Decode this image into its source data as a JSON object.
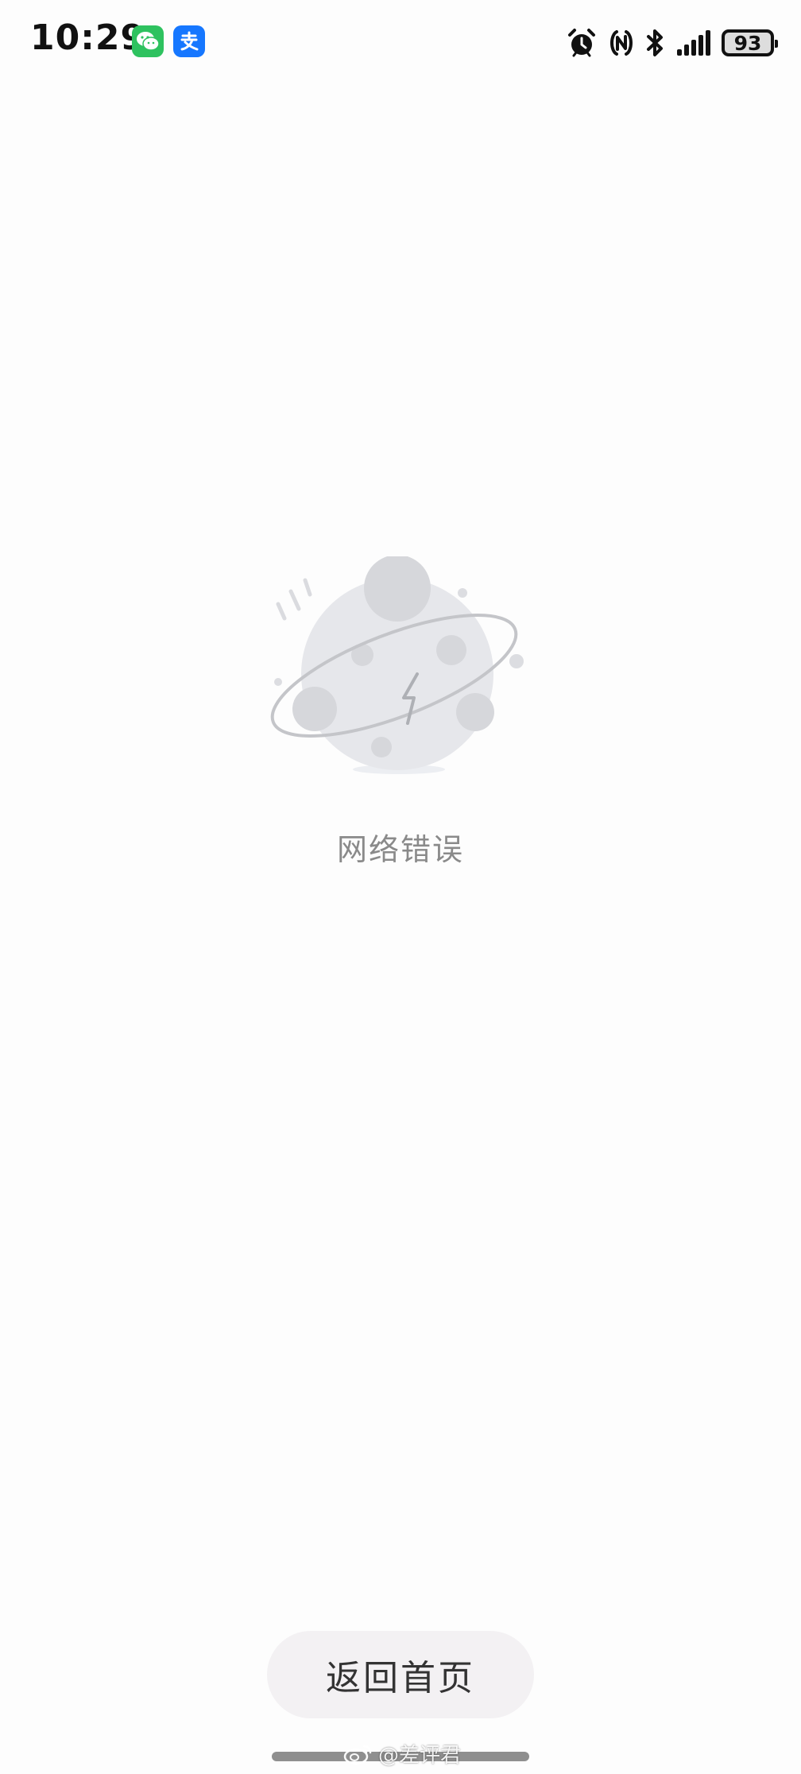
{
  "status_bar": {
    "time": "10:29",
    "battery_level": "93",
    "notification_apps": [
      "wechat-icon",
      "alipay-icon"
    ],
    "indicators": [
      "alarm-icon",
      "nfc-icon",
      "bluetooth-icon",
      "signal-icon",
      "battery-icon"
    ]
  },
  "error": {
    "illustration": "planet-broken-connection-icon",
    "message": "网络错误"
  },
  "actions": {
    "home_button_label": "返回首页"
  },
  "watermark": {
    "text": "@差评君"
  },
  "colors": {
    "background": "#fdfdfd",
    "message_text": "#8a8a8a",
    "button_background": "#f3f1f3",
    "wechat_green": "#2ec25f",
    "alipay_blue": "#1677ff"
  }
}
